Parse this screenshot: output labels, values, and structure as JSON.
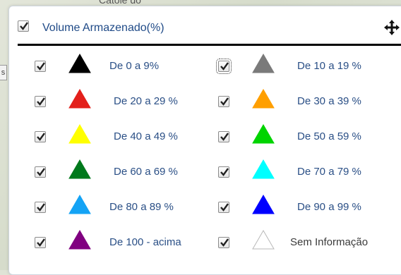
{
  "map": {
    "place_label": "Catolé do"
  },
  "legend": {
    "title": "Volume Armazenado(%)",
    "items": [
      {
        "label": "De 0 a 9%",
        "color": "#000000",
        "checked": true
      },
      {
        "label": "De 10 a 19 %",
        "color": "#7a7a7a",
        "checked": true
      },
      {
        "label": "De 20 a 29 %",
        "color": "#e3201b",
        "checked": true
      },
      {
        "label": "De 30 a 39 %",
        "color": "#ff9f00",
        "checked": true
      },
      {
        "label": "De 40 a 49 %",
        "color": "#ffff00",
        "checked": true
      },
      {
        "label": "De 50 a 59 %",
        "color": "#00d400",
        "checked": true
      },
      {
        "label": "De 60 a 69 %",
        "color": "#00791c",
        "checked": true
      },
      {
        "label": "De 70 a 79 %",
        "color": "#00ffff",
        "checked": true
      },
      {
        "label": "De 80 a 89 %",
        "color": "#14a3f5",
        "checked": true
      },
      {
        "label": "De 90 a 99 %",
        "color": "#0000ff",
        "checked": true
      },
      {
        "label": "De 100 - acima",
        "color": "#800080",
        "checked": true
      },
      {
        "label": "Sem Informação",
        "color": "#ffffff",
        "checked": true
      }
    ]
  }
}
